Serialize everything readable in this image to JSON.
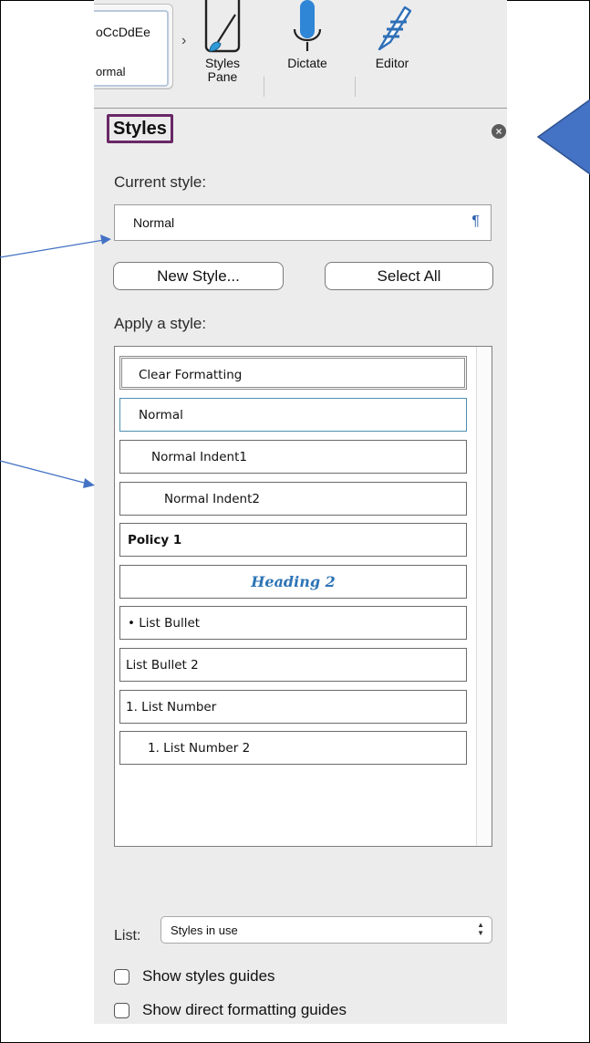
{
  "ribbon": {
    "gallery_sample": "oCcDdEe",
    "gallery_style_name": "ormal",
    "more_glyph": "›",
    "buttons": [
      {
        "label": "Styles",
        "label2": "Pane",
        "icon": "styles-pane-icon"
      },
      {
        "label": "Dictate",
        "icon": "microphone-icon"
      },
      {
        "label": "Editor",
        "icon": "editor-pen-icon"
      }
    ]
  },
  "panel": {
    "title": "Styles",
    "close_icon": "close-icon",
    "current_style_label": "Current style:",
    "current_style_value": "Normal",
    "paragraph_mark": "¶",
    "new_style_button": "New Style...",
    "select_all_button": "Select All",
    "apply_label": "Apply a style:",
    "styles": [
      {
        "label": "Clear Formatting"
      },
      {
        "label": "Normal"
      },
      {
        "label": "Normal Indent1"
      },
      {
        "label": "Normal Indent2"
      },
      {
        "label": "Policy 1"
      },
      {
        "label": "Heading 2"
      },
      {
        "label": "• List Bullet"
      },
      {
        "label": "List Bullet 2"
      },
      {
        "label": "1.  List Number"
      },
      {
        "label": "1.  List Number 2"
      }
    ],
    "list_label": "List:",
    "list_value": "Styles in use",
    "show_styles_guides": "Show styles guides",
    "show_direct_formatting_guides": "Show direct formatting guides"
  },
  "colors": {
    "accent_arrow": "#4472c4",
    "title_outline": "#6a2767",
    "heading2": "#2e74b5"
  }
}
